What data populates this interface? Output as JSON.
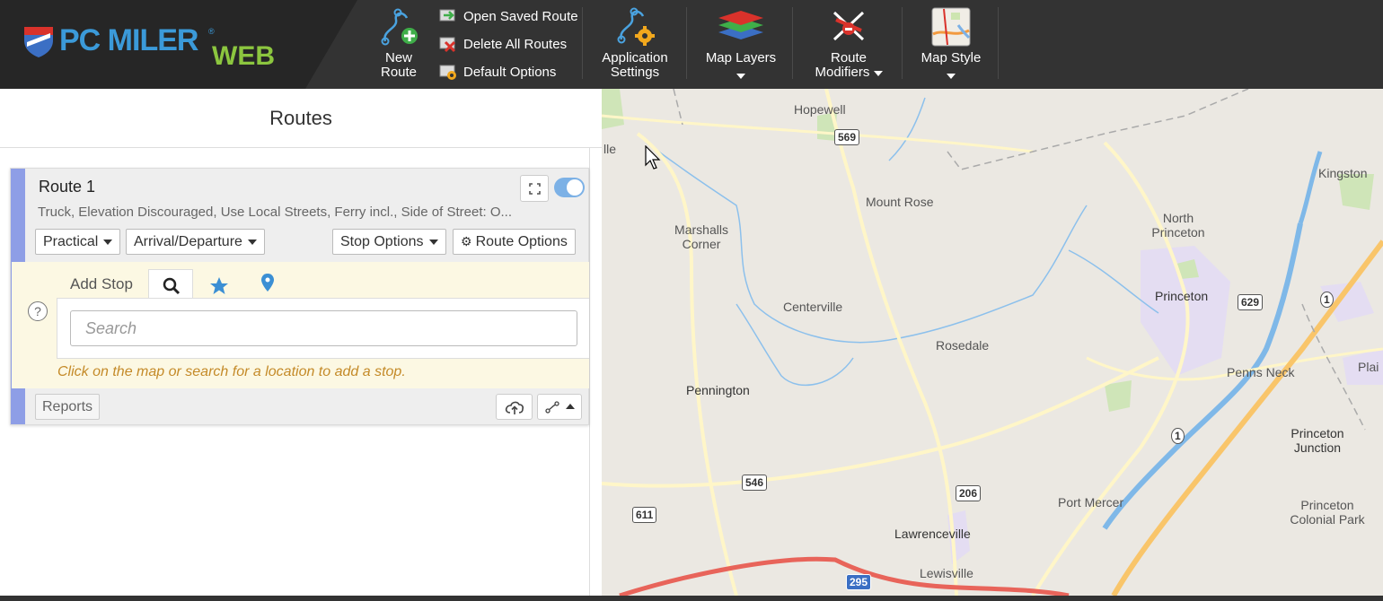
{
  "app": {
    "logo_text_main": "PC MILER",
    "logo_text_sub": "WEB",
    "logo_reg": "®"
  },
  "toolbar": {
    "new_route_line1": "New",
    "new_route_line2": "Route",
    "links": [
      "Open Saved Route",
      "Delete All Routes",
      "Default Options"
    ],
    "app_settings_line1": "Application",
    "app_settings_line2": "Settings",
    "map_layers": "Map Layers",
    "route_modifiers_line1": "Route",
    "route_modifiers_line2": "Modifiers",
    "map_style": "Map Style"
  },
  "routes_panel": {
    "title": "Routes",
    "route": {
      "name": "Route 1",
      "description": "Truck, Elevation Discouraged, Use Local Streets, Ferry incl., Side of Street: O...",
      "enabled": true,
      "routing_type": "Practical",
      "time_mode": "Arrival/Departure",
      "stop_options_label": "Stop Options",
      "route_options_label": "Route Options"
    },
    "add_stop": {
      "label": "Add Stop",
      "help": "?",
      "search_placeholder": "Search",
      "hint": "Click on the map or search for a location to add a stop."
    },
    "reports_label": "Reports"
  },
  "map": {
    "places": [
      {
        "name": "Hopewell"
      },
      {
        "name": "Mount Rose"
      },
      {
        "name": "Marshalls Corner"
      },
      {
        "name": "North Princeton"
      },
      {
        "name": "Kingston"
      },
      {
        "name": "Centerville"
      },
      {
        "name": "Rosedale"
      },
      {
        "name": "Princeton"
      },
      {
        "name": "Penns Neck"
      },
      {
        "name": "Plai"
      },
      {
        "name": "Pennington"
      },
      {
        "name": "Princeton Junction"
      },
      {
        "name": "Port Mercer"
      },
      {
        "name": "Princeton Colonial Park"
      },
      {
        "name": "Lawrenceville"
      },
      {
        "name": "Lewisville"
      },
      {
        "name": "lle"
      }
    ],
    "shields": [
      "569",
      "629",
      "1",
      "1",
      "546",
      "206",
      "611",
      "295"
    ]
  }
}
